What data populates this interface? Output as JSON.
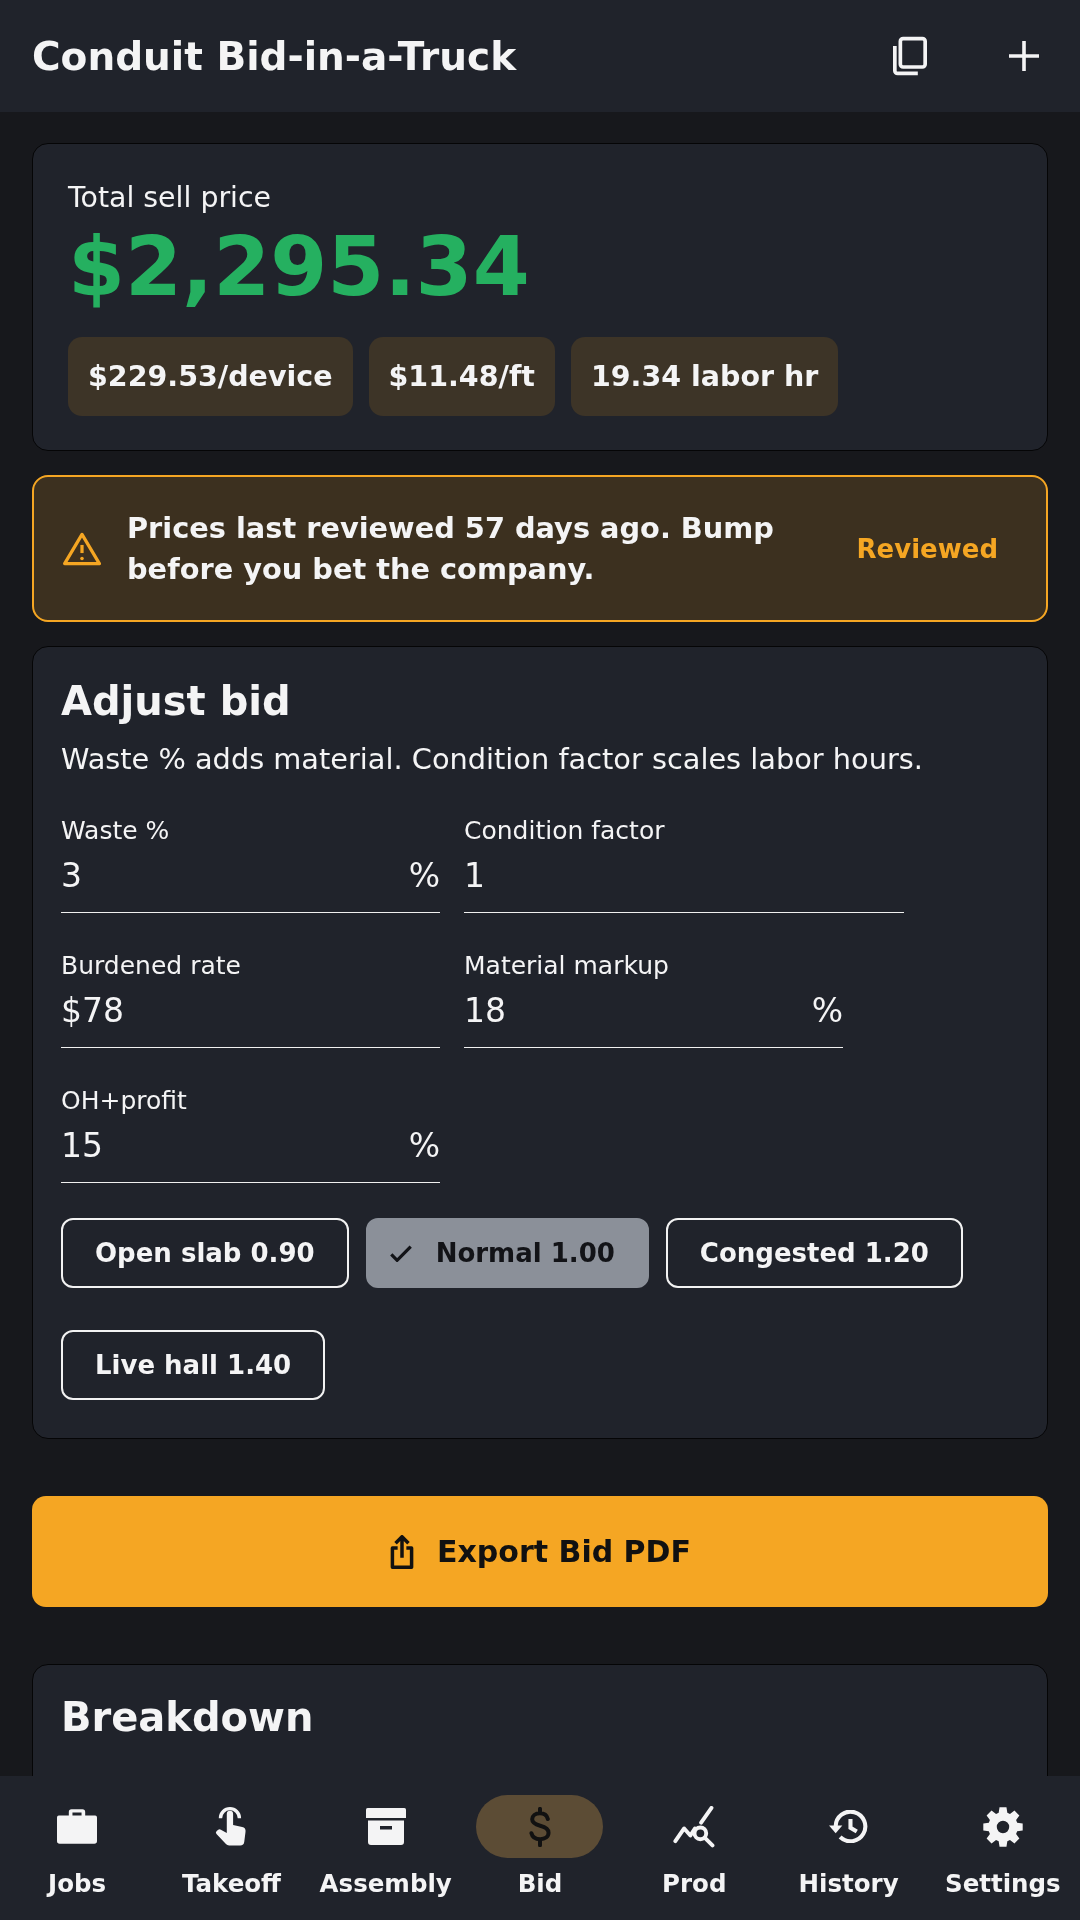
{
  "app_bar": {
    "title": "Conduit Bid-in-a-Truck",
    "actions": [
      {
        "kind": "copy"
      },
      {
        "kind": "add"
      }
    ]
  },
  "summary": {
    "label": "Total sell price",
    "total": "$2,295.34",
    "stats": [
      "$229.53/device",
      "$11.48/ft",
      "19.34 labor hr"
    ]
  },
  "price_warning": {
    "message": "Prices last reviewed 57 days ago. Bump before you bet the company.",
    "action": "Reviewed"
  },
  "adjust_bid": {
    "title": "Adjust bid",
    "description": "Waste % adds material. Condition factor scales labor hours.",
    "fields": [
      {
        "label": "Waste %",
        "value": "3",
        "suffix": "%"
      },
      {
        "label": "Condition factor",
        "value": "1"
      },
      {
        "label": "Burdened rate",
        "prefix": "$",
        "value": "78"
      },
      {
        "label": "Material markup",
        "value": "18",
        "suffix": "%"
      },
      {
        "label": "OH+profit",
        "value": "15",
        "suffix": "%"
      }
    ],
    "conditions": [
      {
        "label": "Open slab 0.90",
        "selected": false
      },
      {
        "label": "Normal 1.00",
        "selected": true
      },
      {
        "label": "Congested 1.20",
        "selected": false
      },
      {
        "label": "Live hall 1.40",
        "selected": false
      }
    ]
  },
  "export_button": {
    "label": "Export Bid PDF"
  },
  "breakdown": {
    "title": "Breakdown"
  },
  "bottom_nav": [
    {
      "label": "Jobs",
      "kind": "briefcase",
      "selected": false
    },
    {
      "label": "Takeoff",
      "kind": "touch",
      "selected": false
    },
    {
      "label": "Assembly",
      "kind": "archive",
      "selected": false
    },
    {
      "label": "Bid",
      "kind": "dollar",
      "selected": true
    },
    {
      "label": "Prod",
      "kind": "stats",
      "selected": false
    },
    {
      "label": "History",
      "kind": "history",
      "selected": false
    },
    {
      "label": "Settings",
      "kind": "gear",
      "selected": false
    }
  ]
}
